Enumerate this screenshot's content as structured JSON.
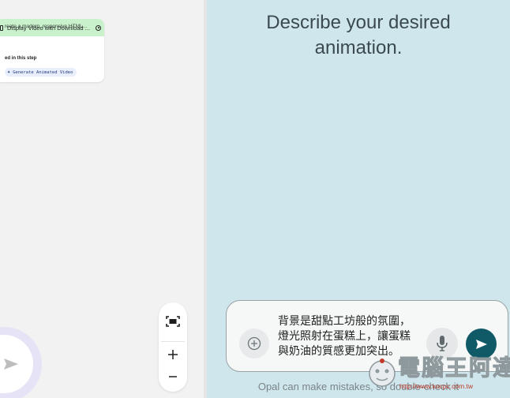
{
  "canvas": {
    "node": {
      "title": "Display Video with Download ...",
      "description": "reate a modern, responsive HTML...",
      "used_label": "ed in this step",
      "chip_label": "Generate Animated Video",
      "doc_icon": "document-icon",
      "menu_icon": "node-menu-icon",
      "chip_icon": "sparkle-icon",
      "header_color": "#c9f2cc"
    },
    "send_icon": "send-arrow-icon",
    "zoom": {
      "fit_icon": "fit-view-icon",
      "zoom_in_icon": "plus-icon",
      "zoom_out_icon": "minus-icon"
    }
  },
  "panel": {
    "heading_line1": "Describe your desired",
    "heading_line2": "animation.",
    "prompt_value": "背景是甜點工坊般的氛圍，\n燈光照射在蛋糕上，讓蛋糕\n與奶油的質感更加突出。",
    "attach_icon": "add-circle-icon",
    "mic_icon": "microphone-icon",
    "submit_icon": "send-icon",
    "disclaimer": "Opal can make mistakes, so double-check it",
    "background_color": "#cfe6ec",
    "submit_color": "#0f5a66"
  },
  "watermark": {
    "text": "電腦王阿達",
    "url": "http://www.kocpc.com.tw"
  }
}
